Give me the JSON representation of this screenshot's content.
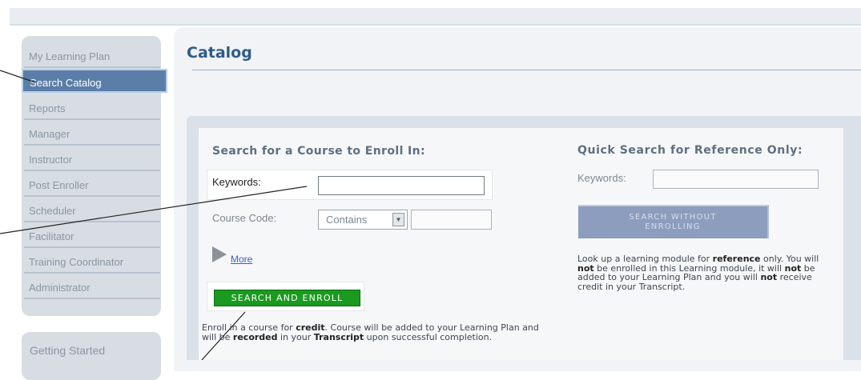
{
  "sidebar": {
    "items": [
      {
        "label": "My Learning Plan",
        "active": false
      },
      {
        "label": "Search Catalog",
        "active": true
      },
      {
        "label": "Reports",
        "active": false
      },
      {
        "label": "Manager",
        "active": false
      },
      {
        "label": "Instructor",
        "active": false
      },
      {
        "label": "Post Enroller",
        "active": false
      },
      {
        "label": "Scheduler",
        "active": false
      },
      {
        "label": "Facilitator",
        "active": false
      },
      {
        "label": "Training Coordinator",
        "active": false
      },
      {
        "label": "Administrator",
        "active": false
      }
    ],
    "getting_started": "Getting Started"
  },
  "page": {
    "title": "Catalog"
  },
  "enroll_search": {
    "heading": "Search for a Course to Enroll In:",
    "keywords_label": "Keywords:",
    "keywords_value": "",
    "course_code_label": "Course Code:",
    "match_option": "Contains",
    "course_code_value": "",
    "more_label": "More",
    "button_label": "SEARCH AND ENROLL",
    "help": {
      "p1": "Enroll in a course for ",
      "b1": "credit",
      "p2": ". Course will be added to your Learning Plan and will be ",
      "b2": "recorded",
      "p3": " in your ",
      "b3": "Transcript",
      "p4": " upon successful completion."
    }
  },
  "quick_search": {
    "heading": "Quick Search for Reference Only:",
    "keywords_label": "Keywords:",
    "keywords_value": "",
    "button_label": "SEARCH WITHOUT ENROLLING",
    "help": {
      "p1": "Look up a learning module for ",
      "b1": "reference",
      "p2": " only. You will ",
      "b2": "not",
      "p3": " be enrolled in this Learning module, it will ",
      "b3": "not",
      "p4": " be added to your Learning Plan and you will ",
      "b4": "not",
      "p5": " receive credit in your Transcript."
    }
  },
  "colors": {
    "title": "#2e5c8a",
    "active_nav": "#5b7ea8",
    "enroll_button": "#1a9a1e",
    "quick_button": "#8c9dbd",
    "link": "#3a62c4"
  }
}
